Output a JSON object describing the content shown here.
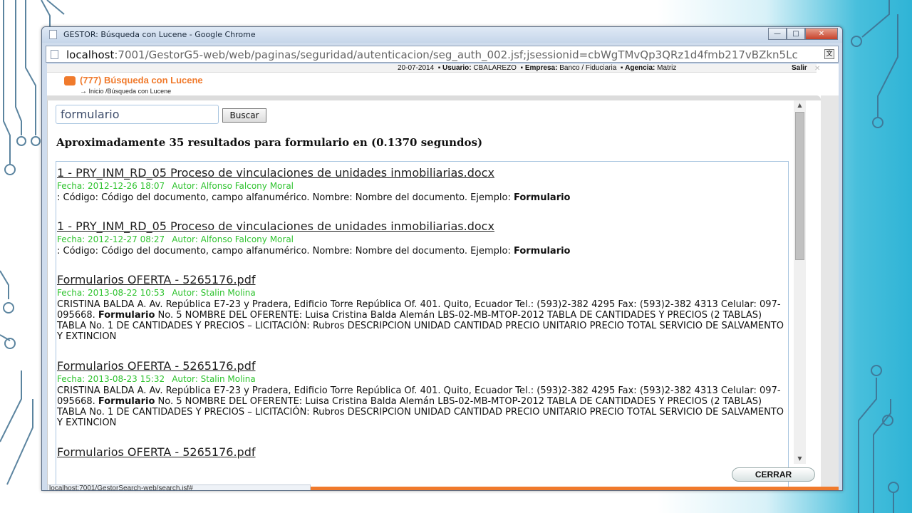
{
  "window": {
    "title": "GESTOR: Búsqueda con Lucene - Google Chrome",
    "controls": {
      "minimize": "—",
      "maximize": "□",
      "close": "✕"
    }
  },
  "address": {
    "host": "localhost",
    "path": ":7001/GestorG5-web/web/paginas/seguridad/autenticacion/seg_auth_002.jsf;jsessionid=cbWgTMvQp3QRz1d4fmb217vBZkn5Lc"
  },
  "statusbar": {
    "date": "20-07-2014",
    "usuario_label": "Usuario:",
    "usuario": "CBALAREZO",
    "empresa_label": "Empresa:",
    "empresa": "Banco / Fiduciaria",
    "agencia_label": "Agencia:",
    "agencia": "Matriz",
    "salir": "Salir"
  },
  "header": {
    "title": "(777) Búsqueda con Lucene",
    "breadcrumb": "Inicio /Búsqueda con Lucene"
  },
  "search": {
    "value": "formulario",
    "button": "Buscar",
    "summary": "Aproximadamente 35 resultados para formulario en (0.1370 segundos)"
  },
  "results": [
    {
      "title": "1 - PRY_INM_RD_05 Proceso de vinculaciones de unidades inmobiliarias.docx",
      "fecha": "Fecha: 2012-12-26 18:07",
      "autor": "Autor: Alfonso Falcony Moral",
      "snippet_pre": ": Código: Código del documento, campo alfanumérico. Nombre: Nombre del documento. Ejemplo: ",
      "snippet_bold": "Formulario",
      "snippet_post": ""
    },
    {
      "title": "1 - PRY_INM_RD_05 Proceso de vinculaciones de unidades inmobiliarias.docx",
      "fecha": "Fecha: 2012-12-27 08:27",
      "autor": "Autor: Alfonso Falcony Moral",
      "snippet_pre": ": Código: Código del documento, campo alfanumérico. Nombre: Nombre del documento. Ejemplo: ",
      "snippet_bold": "Formulario",
      "snippet_post": ""
    },
    {
      "title": "Formularios OFERTA - 5265176.pdf",
      "fecha": "Fecha: 2013-08-22 10:53",
      "autor": "Autor: Stalin Molina",
      "snippet_pre": "CRISTINA BALDA A. Av. República E7-23 y Pradera, Edificio Torre República Of. 401. Quito, Ecuador Tel.: (593)2-382 4295 Fax: (593)2-382 4313 Celular: 097-095668. ",
      "snippet_bold": "Formulario",
      "snippet_post": " No. 5 NOMBRE DEL OFERENTE: Luisa Cristina Balda Alemán LBS-02-MB-MTOP-2012 TABLA DE CANTIDADES Y PRECIOS (2 TABLAS) TABLA No. 1 DE CANTIDADES Y PRECIOS – LICITACIÓN: Rubros DESCRIPCION UNIDAD CANTIDAD PRECIO UNITARIO PRECIO TOTAL SERVICIO DE SALVAMENTO Y EXTINCION"
    },
    {
      "title": "Formularios OFERTA - 5265176.pdf",
      "fecha": "Fecha: 2013-08-23 15:32",
      "autor": "Autor: Stalin Molina",
      "snippet_pre": "CRISTINA BALDA A. Av. República E7-23 y Pradera, Edificio Torre República Of. 401. Quito, Ecuador Tel.: (593)2-382 4295 Fax: (593)2-382 4313 Celular: 097-095668. ",
      "snippet_bold": "Formulario",
      "snippet_post": " No. 5 NOMBRE DEL OFERENTE: Luisa Cristina Balda Alemán LBS-02-MB-MTOP-2012 TABLA DE CANTIDADES Y PRECIOS (2 TABLAS) TABLA No. 1 DE CANTIDADES Y PRECIOS – LICITACIÓN: Rubros DESCRIPCION UNIDAD CANTIDAD PRECIO UNITARIO PRECIO TOTAL SERVICIO DE SALVAMENTO Y EXTINCION"
    },
    {
      "title": "Formularios OFERTA - 5265176.pdf"
    }
  ],
  "footer": {
    "cerrar": "CERRAR",
    "status_url": "localhost:7001/GestorSearch-web/search.jsf#"
  }
}
